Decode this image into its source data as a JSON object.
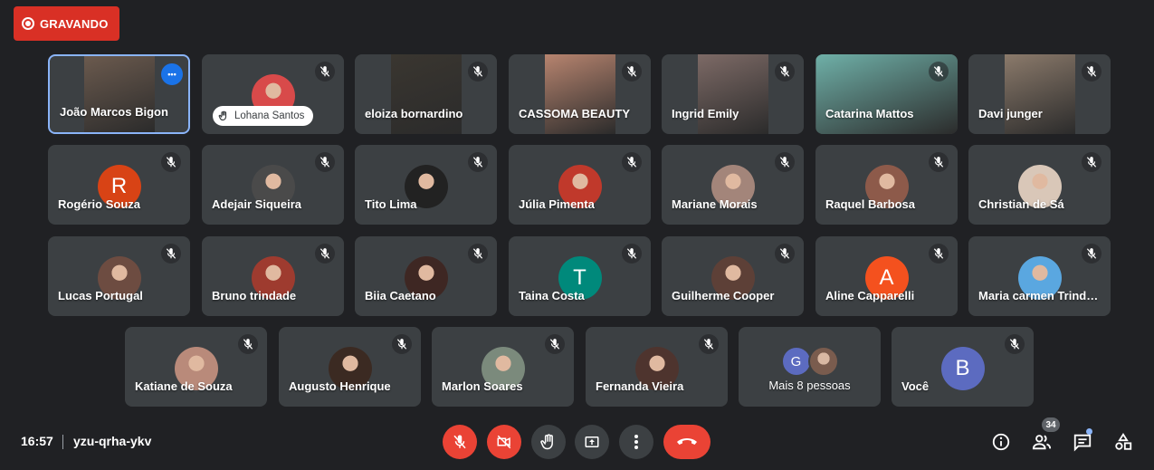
{
  "recording": {
    "label": "GRAVANDO"
  },
  "grid": {
    "tiles": [
      {
        "name": "João Marcos Bigon",
        "kind": "video",
        "bg": "#6b5a4e",
        "active": true,
        "muted": false
      },
      {
        "name": "",
        "kind": "avatar-photo",
        "bg": "#d84a4a",
        "muted": true,
        "pill": "Lohana Santos"
      },
      {
        "name": "eloiza bornardino",
        "kind": "video",
        "bg": "#3a3630",
        "muted": true
      },
      {
        "name": "CASSOMA BEAUTY",
        "kind": "video",
        "bg": "#b7846f",
        "muted": true
      },
      {
        "name": "Ingrid Emily",
        "kind": "video",
        "bg": "#7d6a66",
        "muted": true
      },
      {
        "name": "Catarina Mattos",
        "kind": "video-wide",
        "bg": "#6fb0a8",
        "muted": true
      },
      {
        "name": "Davi junger",
        "kind": "video",
        "bg": "#8b7a6b",
        "muted": true
      },
      {
        "name": "Rogério Souza",
        "kind": "letter",
        "letter": "R",
        "bg": "#d84315",
        "muted": true
      },
      {
        "name": "Adejair Siqueira",
        "kind": "avatar-photo",
        "bg": "#4a4a4a",
        "muted": true
      },
      {
        "name": "Tito Lima",
        "kind": "avatar-photo",
        "bg": "#222222",
        "muted": true
      },
      {
        "name": "Júlia Pimenta",
        "kind": "avatar-photo",
        "bg": "#c0392b",
        "muted": true
      },
      {
        "name": "Mariane Morais",
        "kind": "avatar-photo",
        "bg": "#a3857a",
        "muted": true
      },
      {
        "name": "Raquel Barbosa",
        "kind": "avatar-photo",
        "bg": "#8d5a4a",
        "muted": true
      },
      {
        "name": "Christian de Sá",
        "kind": "avatar-photo",
        "bg": "#d9c7b8",
        "muted": true
      },
      {
        "name": "Lucas Portugal",
        "kind": "avatar-photo",
        "bg": "#6d4c41",
        "muted": true
      },
      {
        "name": "Bruno trindade",
        "kind": "avatar-photo",
        "bg": "#9e3b2f",
        "muted": true
      },
      {
        "name": "Biia Caetano",
        "kind": "avatar-photo",
        "bg": "#3e2723",
        "muted": true
      },
      {
        "name": "Taina Costa",
        "kind": "letter",
        "letter": "T",
        "bg": "#00897b",
        "muted": true
      },
      {
        "name": "Guilherme Cooper",
        "kind": "avatar-photo",
        "bg": "#5d4037",
        "muted": true
      },
      {
        "name": "Aline Capparelli",
        "kind": "letter",
        "letter": "A",
        "bg": "#f4511e",
        "muted": true
      },
      {
        "name": "Maria carmen Trindade",
        "kind": "avatar-photo",
        "bg": "#5aa7e0",
        "muted": true
      },
      {
        "name": "Katiane de Souza",
        "kind": "avatar-photo",
        "bg": "#b98a7a",
        "muted": true
      },
      {
        "name": "Augusto Henrique",
        "kind": "avatar-photo",
        "bg": "#3b2a22",
        "muted": true
      },
      {
        "name": "Marlon Soares",
        "kind": "avatar-photo",
        "bg": "#7b8a7c",
        "muted": true
      },
      {
        "name": "Fernanda Vieira",
        "kind": "avatar-photo",
        "bg": "#4e342e",
        "muted": true
      },
      {
        "name": "Mais 8 pessoas",
        "kind": "more",
        "muted": false,
        "more_letter": "G",
        "more_bg": "#5c6bc0"
      },
      {
        "name": "Você",
        "kind": "letter",
        "letter": "B",
        "bg": "#5c6bc0",
        "muted": true
      }
    ]
  },
  "footer": {
    "time": "16:57",
    "meeting_code": "yzu-qrha-ykv",
    "participants_count": "34"
  },
  "colors": {
    "accent_red": "#ea4335",
    "tile_bg": "#3c4043",
    "page_bg": "#202124",
    "active_border": "#8ab4f8"
  }
}
